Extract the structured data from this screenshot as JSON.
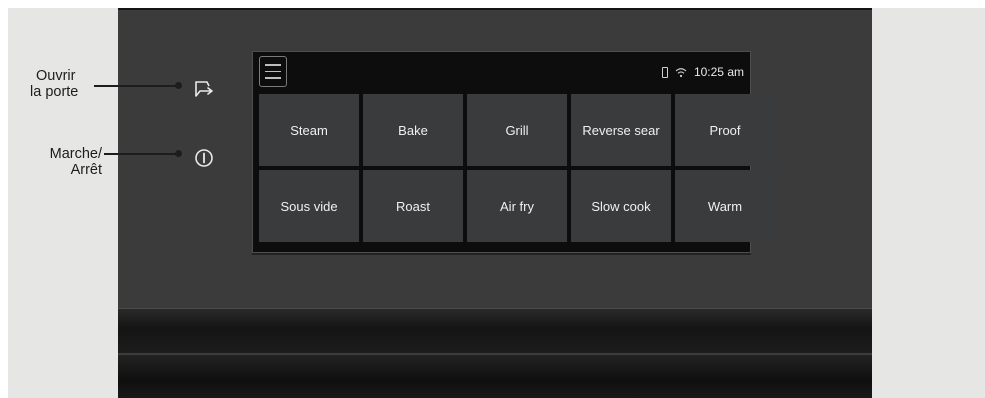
{
  "callouts": {
    "door_line1": "Ouvrir",
    "door_line2": "la porte",
    "power_line1": "Marche/",
    "power_line2": "Arrêt"
  },
  "icons": {
    "door": "door-open-icon",
    "power": "power-icon",
    "menu": "hamburger-menu-icon",
    "phone": "phone-icon",
    "wifi": "wifi-icon"
  },
  "status": {
    "time": "10:25 am"
  },
  "modes": [
    "Steam",
    "Bake",
    "Grill",
    "Reverse sear",
    "Proof",
    "Sous vide",
    "Roast",
    "Air fry",
    "Slow cook",
    "Warm"
  ],
  "colors": {
    "panel": "#3b3b3b",
    "screen": "#0d0d0d",
    "tile": "#3a3b3d",
    "background": "#e6e7e5"
  }
}
